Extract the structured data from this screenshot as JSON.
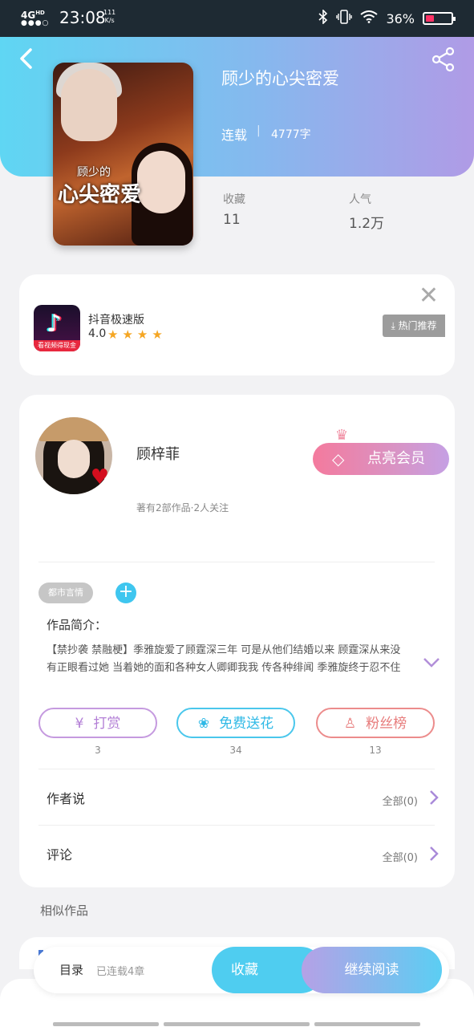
{
  "status_bar": {
    "network": "4G",
    "network_sup": "HD",
    "signal": "●●●○",
    "time": "23:08",
    "speed_value": "111",
    "speed_unit": "K/s",
    "battery": "36%"
  },
  "header": {
    "back_icon": "‹",
    "book_title": "顾少的心尖密爱",
    "status": "连载",
    "separator": "|",
    "word_count": "4777字",
    "cover_title": "心尖密爱",
    "cover_subtitle": "顾少的",
    "stats": [
      {
        "label": "收藏",
        "value": "11"
      },
      {
        "label": "人气",
        "value": "1.2万"
      }
    ]
  },
  "ad": {
    "close_icon": "✕",
    "app_name": "抖音极速版",
    "rating": "4.0",
    "stars": "★★★★",
    "icon_strip": "看视频得现金",
    "button": "⤓ 热门推荐"
  },
  "author": {
    "name": "顾梓菲",
    "meta": "著有2部作品·2人关注",
    "vip_button": "点亮会员",
    "vip_gem": "◇",
    "crown": "♛"
  },
  "book": {
    "tag": "都市言情",
    "add_tag": "+",
    "intro_label": "作品简介：",
    "intro": "【禁抄袭 禁融梗】季雅旋爱了顾霆深三年 可是从他们结婚以来 顾霆深从来没有正眼看过她  当着她的面和各种女人卿卿我我 传各种绯闻 季雅旋终于忍不住了：“…",
    "expand_icon": "⌄"
  },
  "actions": [
    {
      "label": "打赏",
      "icon": "¥",
      "count": "3"
    },
    {
      "label": "免费送花",
      "icon": "❀",
      "count": "34"
    },
    {
      "label": "粉丝榜",
      "icon": "♙",
      "count": "13"
    }
  ],
  "rows": [
    {
      "label": "作者说",
      "right": "全部(0)",
      "chevron": "›"
    },
    {
      "label": "评论",
      "right": "全部(0)",
      "chevron": "›"
    }
  ],
  "similar": {
    "title": "相似作品"
  },
  "bottom_bar": {
    "toc": "目录",
    "chapters": "已连载4章",
    "collect": "收藏",
    "read": "继续阅读"
  },
  "colors": {
    "header_gradient_start": "#5fd6f3",
    "header_gradient_end": "#b09be6",
    "accent_blue": "#4fcdf0",
    "accent_purple": "#b37fd6"
  }
}
